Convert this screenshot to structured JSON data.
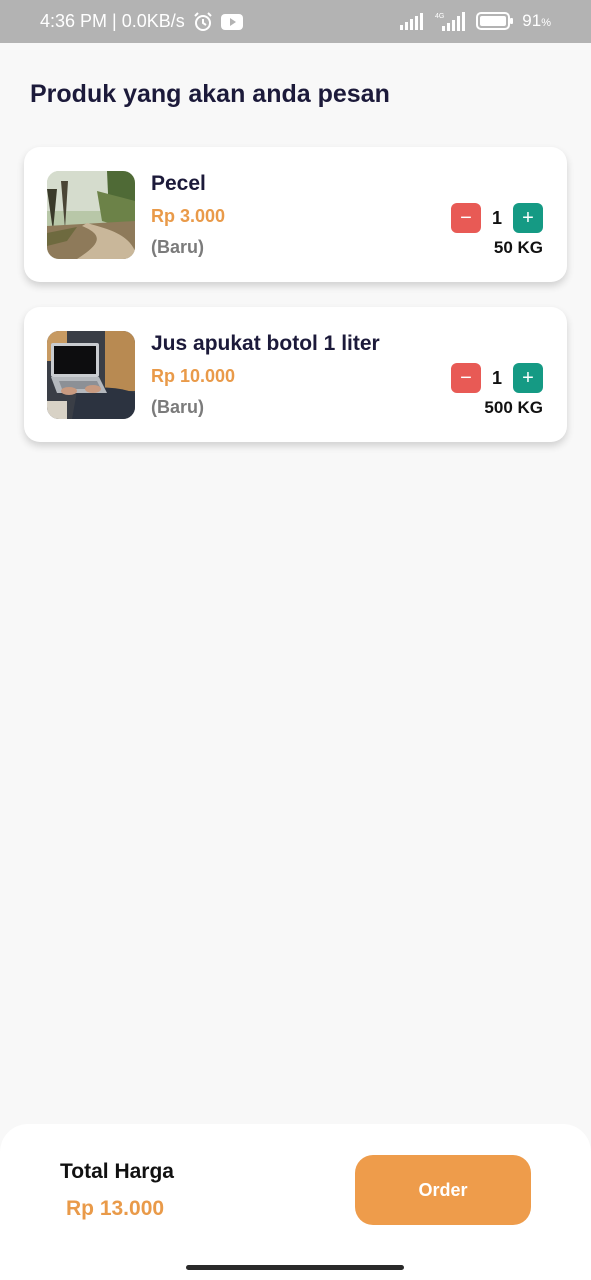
{
  "status_bar": {
    "time_speed": "4:36 PM | 0.0KB/s",
    "network_label": "4G",
    "battery_percent": "91",
    "battery_unit": "%",
    "icons": [
      "alarm-icon",
      "youtube-icon",
      "signal-icon",
      "signal-4g-icon",
      "battery-icon"
    ]
  },
  "page": {
    "title": "Produk yang akan anda pesan"
  },
  "products": [
    {
      "name": "Pecel",
      "price": "Rp 3.000",
      "condition": "(Baru)",
      "quantity": "1",
      "weight": "50 KG",
      "minus_label": "−",
      "plus_label": "+"
    },
    {
      "name": "Jus apukat botol 1 liter",
      "price": "Rp 10.000",
      "condition": "(Baru)",
      "quantity": "1",
      "weight": "500 KG",
      "minus_label": "−",
      "plus_label": "+"
    }
  ],
  "summary": {
    "total_label": "Total Harga",
    "total_value": "Rp 13.000",
    "order_label": "Order"
  },
  "colors": {
    "accent_orange": "#ee9c4b",
    "price_orange": "#e99a49",
    "minus_red": "#e85a55",
    "plus_teal": "#159a84",
    "title_navy": "#1c1a3a"
  }
}
